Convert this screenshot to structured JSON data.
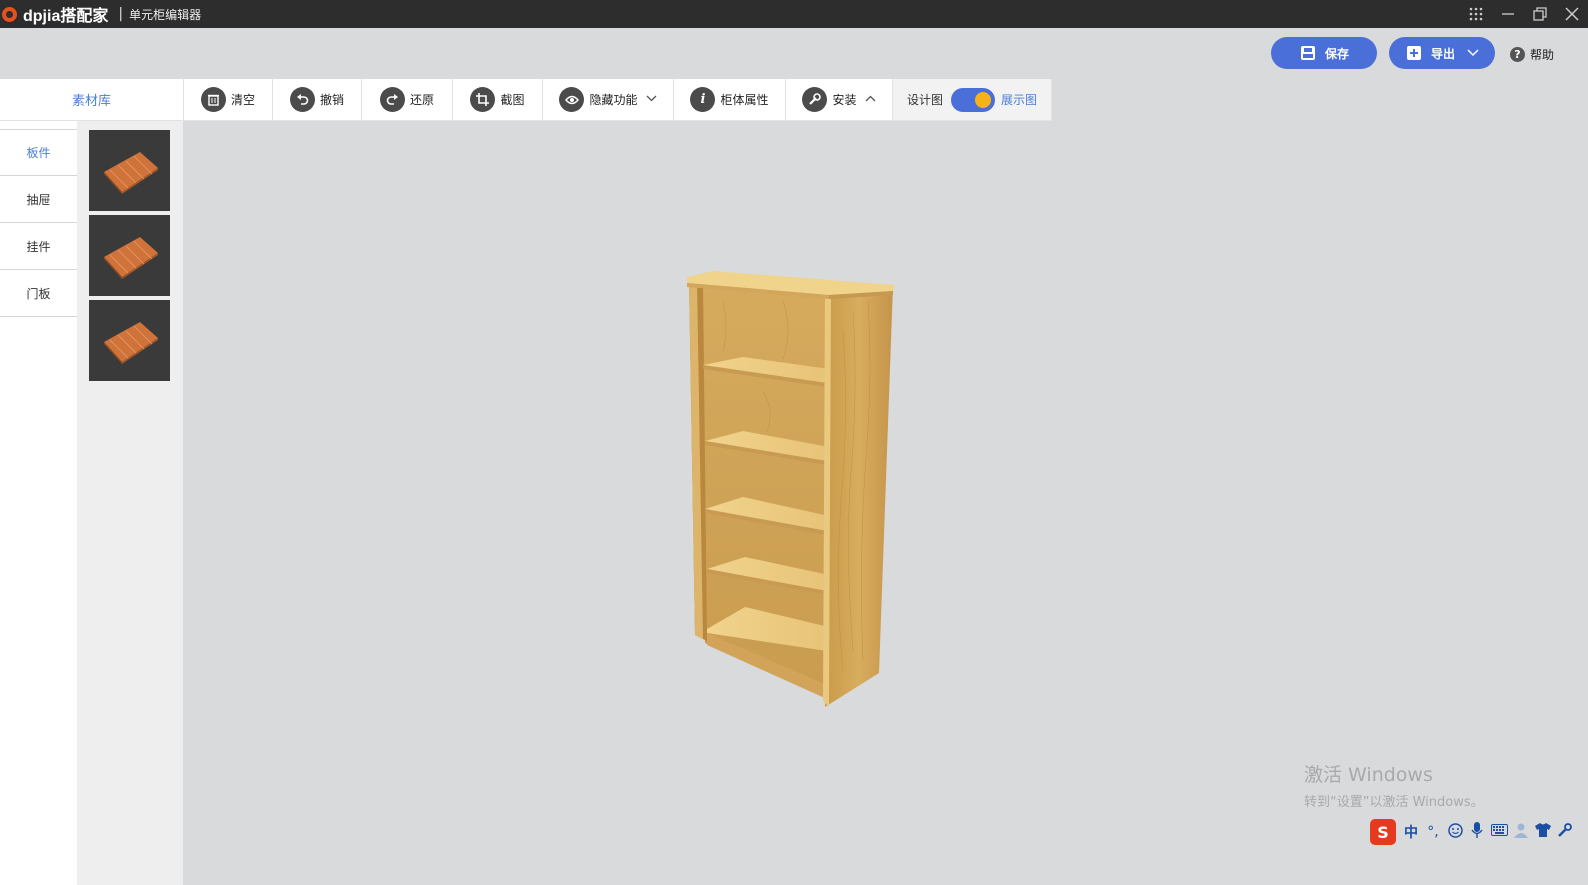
{
  "titlebar": {
    "logo_text": "dpjia搭配家",
    "separator": "|",
    "app_name": "单元柜编辑器",
    "controls": [
      "grid-icon",
      "minimize-icon",
      "restore-icon",
      "close-icon"
    ]
  },
  "actions": {
    "save_label": "保存",
    "export_label": "导出",
    "help_label": "帮助"
  },
  "library": {
    "header": "素材库",
    "categories": [
      "板件",
      "抽屉",
      "挂件",
      "门板"
    ],
    "active_category": "板件",
    "thumbnails": [
      "wood-board-thumbnail",
      "wood-board-thumbnail",
      "wood-board-thumbnail"
    ]
  },
  "toolbar": {
    "items": [
      {
        "label": "清空",
        "icon": "trash-icon"
      },
      {
        "label": "撤销",
        "icon": "undo-icon"
      },
      {
        "label": "还原",
        "icon": "redo-icon"
      },
      {
        "label": "截图",
        "icon": "crop-icon"
      },
      {
        "label": "隐藏功能",
        "icon": "eye-icon"
      },
      {
        "label": "柜体属性",
        "icon": "info-icon"
      },
      {
        "label": "安装",
        "icon": "wrench-icon"
      }
    ],
    "view_toggle": {
      "left_label": "设计图",
      "right_label": "展示图",
      "state": "展示图"
    }
  },
  "watermark": {
    "line1": "激活 Windows",
    "line2": "转到“设置”以激活 Windows。"
  },
  "ime": {
    "logo": "S",
    "mode": "中",
    "punct": "°,",
    "icons": [
      "emoji-icon",
      "microphone-icon",
      "keyboard-icon",
      "user-icon",
      "shirt-icon",
      "wrench-icon"
    ]
  },
  "colors": {
    "accent": "#4a6fd8",
    "link": "#4a7fd6",
    "titlebar": "#2d2d2d",
    "canvas": "#d9dadc",
    "toggle_knob": "#f6b21a"
  }
}
